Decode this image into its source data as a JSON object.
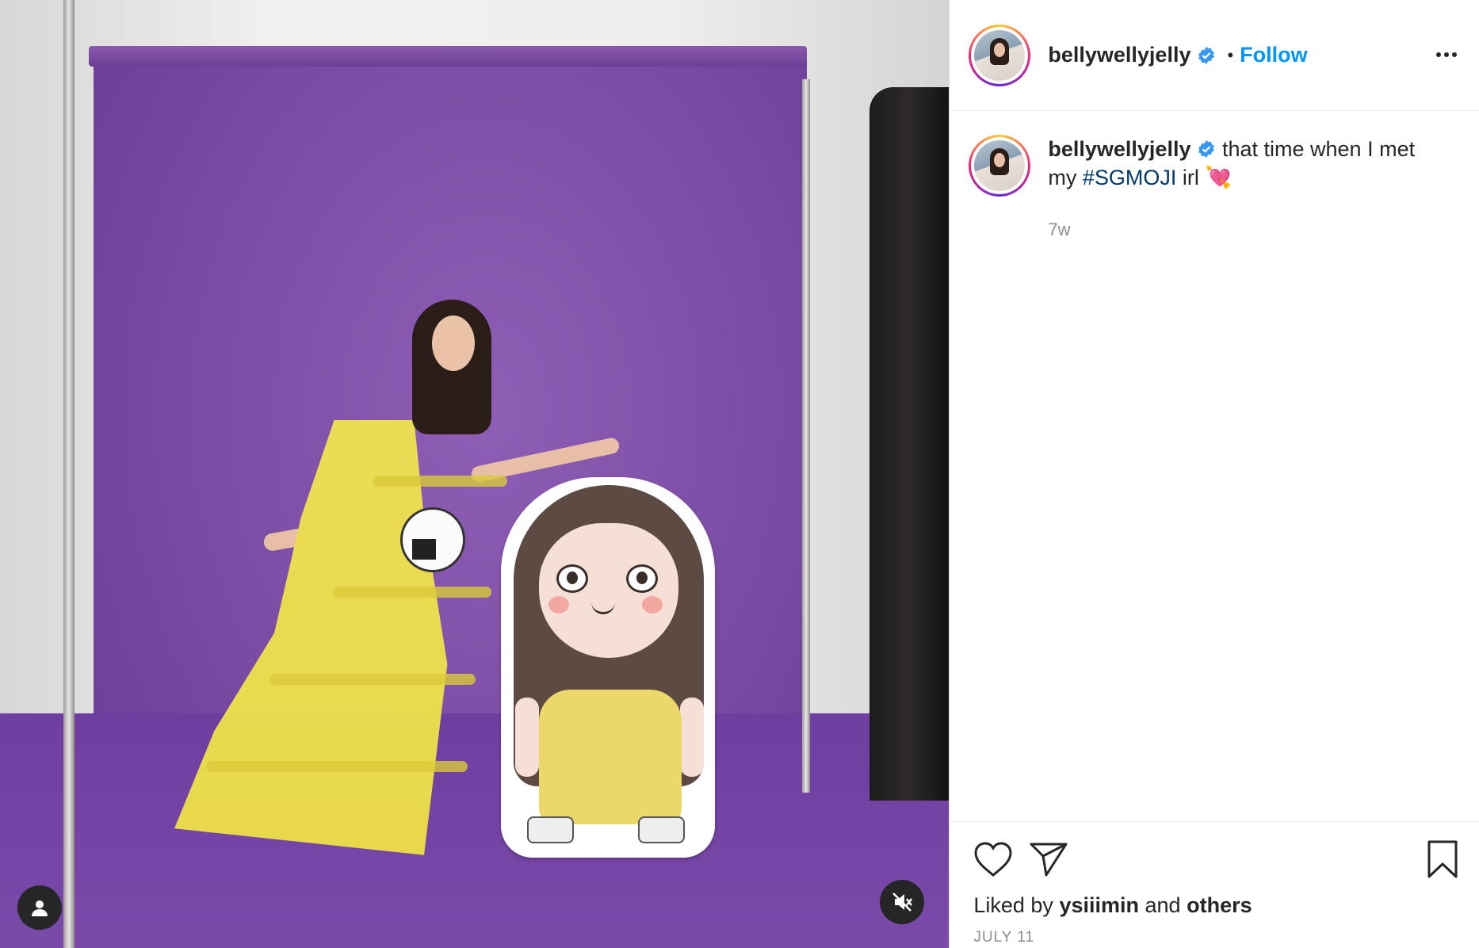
{
  "post": {
    "username": "bellywellyjelly",
    "verified": true,
    "separator": "•",
    "follow_label": "Follow",
    "more_icon": "more-horizontal-icon",
    "caption_text": "that time when I met my",
    "hashtag": "#SGMOJI",
    "caption_suffix": "irl",
    "emoji": "💘",
    "time_ago": "7w",
    "liked_prefix": "Liked by",
    "liked_user": "ysiiimin",
    "liked_and": "and",
    "liked_others": "others",
    "date": "JULY 11"
  },
  "media": {
    "user_tag_icon": "user-tag-icon",
    "mute_icon": "volume-muted-icon",
    "description": ""
  },
  "colors": {
    "link_blue": "#0095f6",
    "hashtag": "#00376b",
    "text": "#262626",
    "muted": "#8e8e8e",
    "verified_badge": "#3897f0"
  }
}
